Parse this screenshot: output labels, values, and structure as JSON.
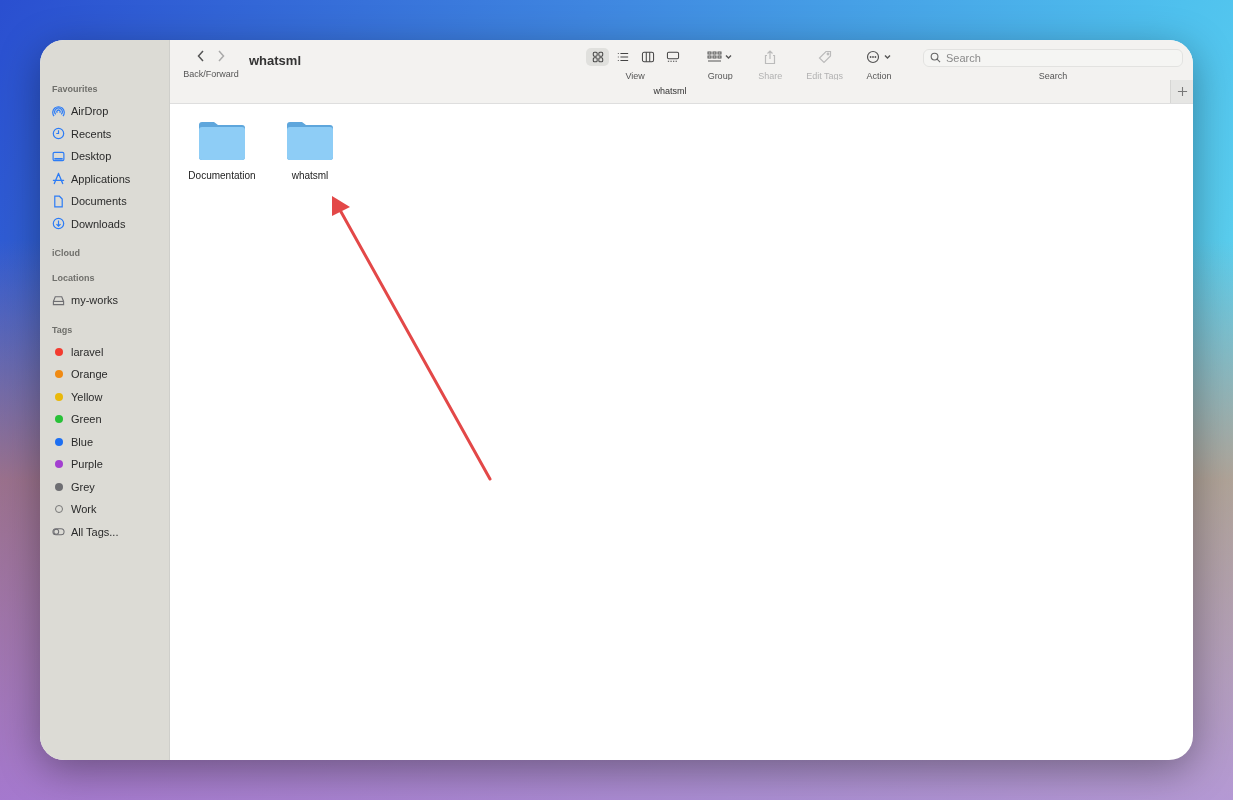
{
  "toolbar": {
    "nav_label": "Back/Forward",
    "title": "whatsml",
    "view_modes": [
      {
        "kind": "icons",
        "selected": true
      },
      {
        "kind": "list",
        "selected": false
      },
      {
        "kind": "columns",
        "selected": false
      },
      {
        "kind": "gallery",
        "selected": false
      }
    ],
    "view_label": "View",
    "actions": [
      {
        "kind": "group",
        "label": "Group",
        "disabled": false
      },
      {
        "kind": "share",
        "label": "Share",
        "disabled": true
      },
      {
        "kind": "tags",
        "label": "Edit Tags",
        "disabled": true
      },
      {
        "kind": "action",
        "label": "Action",
        "disabled": false
      }
    ],
    "search": {
      "placeholder": "Search",
      "label": "Search"
    }
  },
  "tab": {
    "label": "whatsml"
  },
  "sidebar": {
    "sections": [
      {
        "title": "Favourites",
        "items": [
          {
            "kind": "airdrop",
            "label": "AirDrop"
          },
          {
            "kind": "recents",
            "label": "Recents"
          },
          {
            "kind": "desktop",
            "label": "Desktop"
          },
          {
            "kind": "applications",
            "label": "Applications"
          },
          {
            "kind": "documents",
            "label": "Documents"
          },
          {
            "kind": "downloads",
            "label": "Downloads"
          }
        ]
      },
      {
        "title": "iCloud"
      },
      {
        "title": "Locations",
        "items": [
          {
            "kind": "drive",
            "label": "my-works"
          }
        ]
      },
      {
        "title": "Tags",
        "items": [
          {
            "kind": "tag",
            "label": "laravel",
            "color": "#f33b2f"
          },
          {
            "kind": "tag",
            "label": "Orange",
            "color": "#f08a12"
          },
          {
            "kind": "tag",
            "label": "Yellow",
            "color": "#e9b80a"
          },
          {
            "kind": "tag",
            "label": "Green",
            "color": "#28c138"
          },
          {
            "kind": "tag",
            "label": "Blue",
            "color": "#1d6ff2"
          },
          {
            "kind": "tag",
            "label": "Purple",
            "color": "#a33fd0"
          },
          {
            "kind": "tag",
            "label": "Grey",
            "color": "#6e6e72"
          },
          {
            "kind": "hollow",
            "label": "Work"
          },
          {
            "kind": "all",
            "label": "All Tags..."
          }
        ]
      }
    ]
  },
  "files": [
    {
      "name": "Documentation"
    },
    {
      "name": "whatsml"
    }
  ]
}
